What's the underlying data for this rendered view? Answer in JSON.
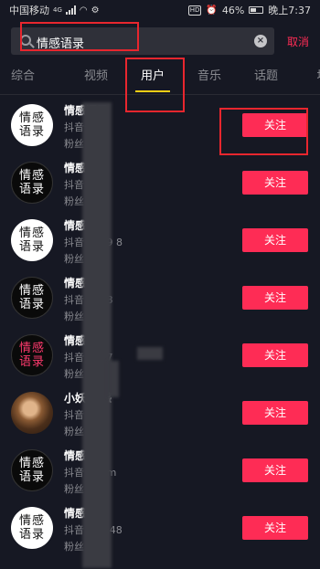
{
  "status_bar": {
    "carrier": "中国移动",
    "network": "4G",
    "battery": "46%",
    "time": "晚上7:37"
  },
  "search": {
    "query": "情感语录",
    "cancel_label": "取消"
  },
  "tabs": [
    {
      "label": "综合",
      "active": false
    },
    {
      "label": "视频",
      "active": false
    },
    {
      "label": "用户",
      "active": true
    },
    {
      "label": "音乐",
      "active": false
    },
    {
      "label": "话题",
      "active": false
    },
    {
      "label": "地",
      "active": false
    }
  ],
  "results": [
    {
      "avatar_top": "情感",
      "avatar_bottom": "语录",
      "avatar_style": "white",
      "name": "情感语录",
      "line2": "抖音号 y",
      "line3": "粉丝 w",
      "follow_label": "关注"
    },
    {
      "avatar_top": "情感",
      "avatar_bottom": "语录",
      "avatar_style": "black",
      "name": "情感",
      "line2": "抖音 169",
      "line3": "粉丝 w",
      "follow_label": "关注"
    },
    {
      "avatar_top": "情感",
      "avatar_bottom": "语录",
      "avatar_style": "white",
      "name": "情感",
      "line2": "抖音 7519 8",
      "line3": "粉丝 w",
      "follow_label": "关注"
    },
    {
      "avatar_top": "情感",
      "avatar_bottom": "语录",
      "avatar_style": "black",
      "name": "情感",
      "line2": "抖音 2168",
      "line3": "粉丝 w",
      "follow_label": "关注"
    },
    {
      "avatar_top": "情感",
      "avatar_bottom": "语录",
      "avatar_style": "pinkword",
      "name": "情感",
      "line2": "抖音 5437",
      "line3": "粉丝 w",
      "follow_label": "关注"
    },
    {
      "avatar_top": "",
      "avatar_bottom": "",
      "avatar_style": "photo",
      "name": "小妖 情感",
      "line2": "抖音 da",
      "line3": "粉丝",
      "follow_label": "关注"
    },
    {
      "avatar_top": "情感",
      "avatar_bottom": "语录",
      "avatar_style": "black",
      "name": "情感",
      "line2": "抖音 k3 tm",
      "line3": "粉丝 w",
      "follow_label": "关注"
    },
    {
      "avatar_top": "情感",
      "avatar_bottom": "语录",
      "avatar_style": "white",
      "name": "情感",
      "line2": "抖音 3o n48",
      "line3": "粉丝 w",
      "follow_label": "关注"
    }
  ]
}
